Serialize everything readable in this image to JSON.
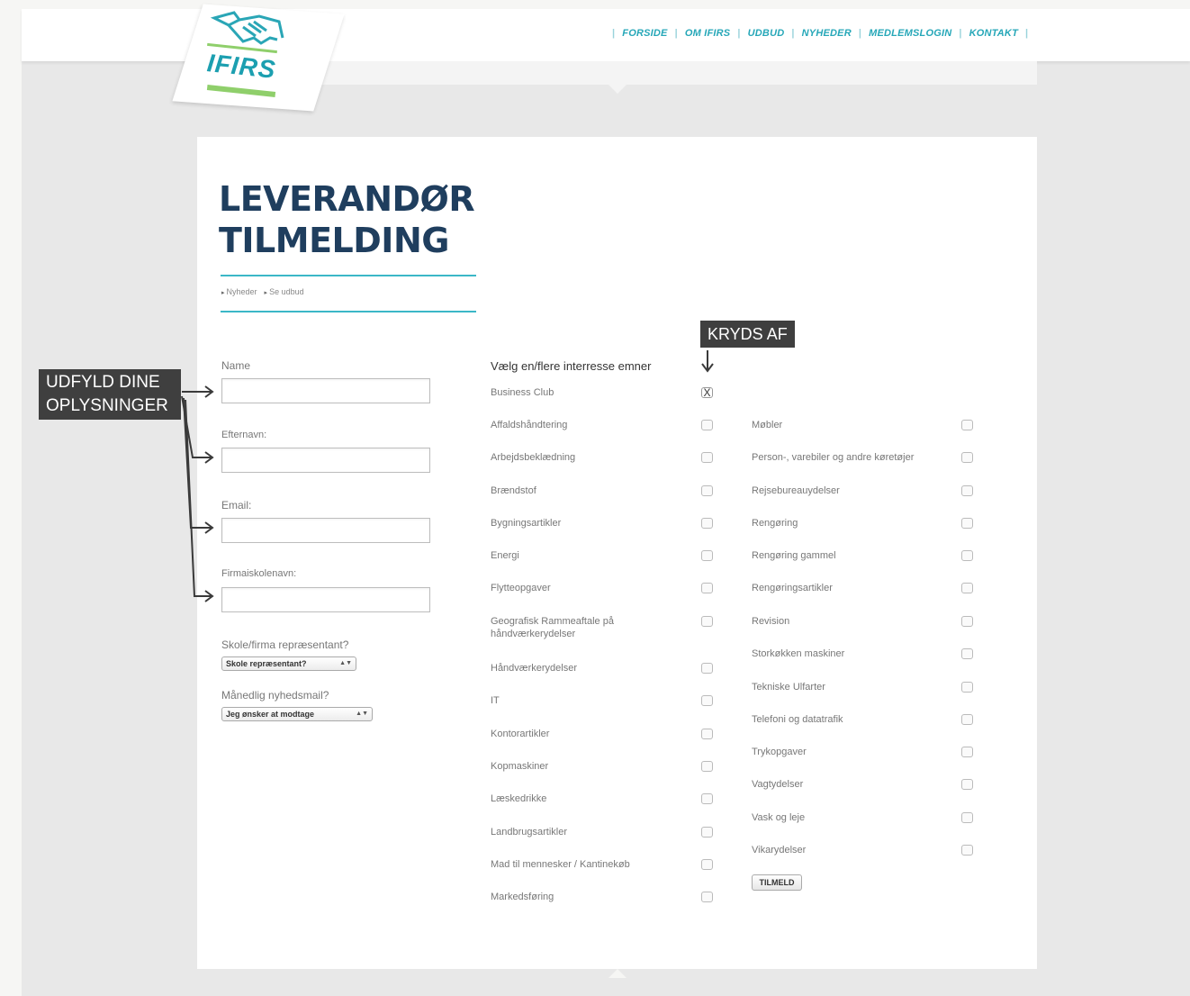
{
  "header": {
    "logo_text": "IFIRS",
    "nav": [
      {
        "label": "FORSIDE",
        "name": "nav-forside"
      },
      {
        "label": "OM IFIRS",
        "name": "nav-om-ifirs"
      },
      {
        "label": "UDBUD",
        "name": "nav-udbud"
      },
      {
        "label": "NYHEDER",
        "name": "nav-nyheder"
      },
      {
        "label": "MEDLEMSLOGIN",
        "name": "nav-medlemslogin"
      },
      {
        "label": "KONTAKT",
        "name": "nav-kontakt"
      }
    ]
  },
  "page": {
    "title_line1": "LEVERANDØR",
    "title_line2": "TILMELDING",
    "breadcrumb": [
      "Nyheder",
      "Se udbud"
    ]
  },
  "form": {
    "name_label": "Name",
    "surname_label": "Efternavn:",
    "email_label": "Email:",
    "company_label": "Firmaiskolenavn:",
    "name_value": "",
    "surname_value": "",
    "email_value": "",
    "company_value": "",
    "rep_label": "Skole/firma repræsentant?",
    "rep_selected": "Skole repræsentant?",
    "newsletter_label": "Månedlig nyhedsmail?",
    "newsletter_selected": "Jeg ønsker at modtage",
    "submit_label": "TILMELD"
  },
  "interests": {
    "heading": "Vælg en/flere interresse emner",
    "checked_mark": "X",
    "col1": [
      {
        "label": "Business Club",
        "checked": true
      },
      {
        "label": "Affaldshåndtering",
        "checked": false
      },
      {
        "label": "Arbejdsbeklædning",
        "checked": false
      },
      {
        "label": "Brændstof",
        "checked": false
      },
      {
        "label": "Bygningsartikler",
        "checked": false
      },
      {
        "label": "Energi",
        "checked": false
      },
      {
        "label": "Flytteopgaver",
        "checked": false
      },
      {
        "label": "Geografisk Rammeaftale på håndværkerydelser",
        "checked": false
      },
      {
        "label": "Håndværkerydelser",
        "checked": false
      },
      {
        "label": "IT",
        "checked": false
      },
      {
        "label": "Kontorartikler",
        "checked": false
      },
      {
        "label": "Kopmaskiner",
        "checked": false
      },
      {
        "label": "Læskedrikke",
        "checked": false
      },
      {
        "label": "Landbrugsartikler",
        "checked": false
      },
      {
        "label": "Mad til mennesker / Kantinekøb",
        "checked": false
      },
      {
        "label": "Markedsføring",
        "checked": false
      }
    ],
    "col2": [
      {
        "label": "Møbler",
        "checked": false
      },
      {
        "label": "Person-, varebiler og andre køretøjer",
        "checked": false
      },
      {
        "label": "Rejsebureauydelser",
        "checked": false
      },
      {
        "label": "Rengøring",
        "checked": false
      },
      {
        "label": "Rengøring gammel",
        "checked": false
      },
      {
        "label": "Rengøringsartikler",
        "checked": false
      },
      {
        "label": "Revision",
        "checked": false
      },
      {
        "label": "Storkøkken maskiner",
        "checked": false
      },
      {
        "label": "Tekniske Ulfarter",
        "checked": false
      },
      {
        "label": "Telefoni og datatrafik",
        "checked": false
      },
      {
        "label": "Trykopgaver",
        "checked": false
      },
      {
        "label": "Vagtydelser",
        "checked": false
      },
      {
        "label": "Vask og leje",
        "checked": false
      },
      {
        "label": "Vikarydelser",
        "checked": false
      }
    ]
  },
  "annotations": {
    "left_callout_line1": "UDFYLD DINE",
    "left_callout_line2": "OPLYSNINGER",
    "top_callout": "KRYDS AF"
  },
  "colors": {
    "accent": "#26a7b8",
    "title": "#1f3e5e",
    "callout_bg": "#3f3f3f"
  }
}
